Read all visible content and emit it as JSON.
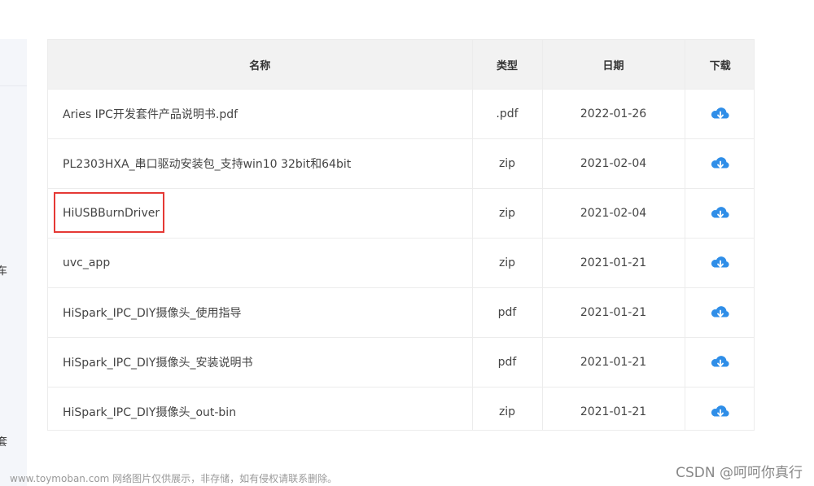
{
  "sidebar": {
    "items": [
      "车",
      "套"
    ]
  },
  "table": {
    "headers": {
      "name": "名称",
      "type": "类型",
      "date": "日期",
      "download": "下载"
    },
    "rows": [
      {
        "name": "Aries IPC开发套件产品说明书.pdf",
        "type": ".pdf",
        "date": "2022-01-26"
      },
      {
        "name": "PL2303HXA_串口驱动安装包_支持win10 32bit和64bit",
        "type": "zip",
        "date": "2021-02-04"
      },
      {
        "name": "HiUSBBurnDriver",
        "type": "zip",
        "date": "2021-02-04"
      },
      {
        "name": "uvc_app",
        "type": "zip",
        "date": "2021-01-21"
      },
      {
        "name": "HiSpark_IPC_DIY摄像头_使用指导",
        "type": "pdf",
        "date": "2021-01-21"
      },
      {
        "name": "HiSpark_IPC_DIY摄像头_安装说明书",
        "type": "pdf",
        "date": "2021-01-21"
      },
      {
        "name": "HiSpark_IPC_DIY摄像头_out-bin",
        "type": "zip",
        "date": "2021-01-21"
      }
    ],
    "download_icon": "cloud-download-icon",
    "icon_color": "#2f8ee8",
    "highlight_color": "#e53935"
  },
  "footer": {
    "watermark": "www.toymoban.com 网络图片仅供展示，非存储，如有侵权请联系删除。",
    "csdn": "CSDN @呵呵你真行"
  }
}
